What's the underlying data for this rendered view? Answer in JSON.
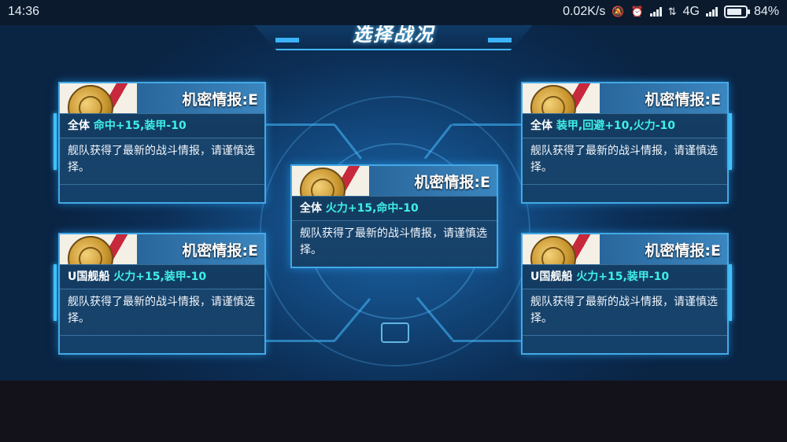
{
  "status_bar": {
    "time": "14:36",
    "net_speed": "0.02K/s",
    "network_type": "4G",
    "battery": "84%"
  },
  "screen": {
    "title": "选择战况"
  },
  "cards": [
    {
      "title": "机密情报:E",
      "target": "全体",
      "effect": "命中+15,装甲-10",
      "description": "舰队获得了最新的战斗情报，请谨慎选择。"
    },
    {
      "title": "机密情报:E",
      "target": "全体",
      "effect": "装甲,回避+10,火力-10",
      "description": "舰队获得了最新的战斗情报，请谨慎选择。"
    },
    {
      "title": "机密情报:E",
      "target": "全体",
      "effect": "火力+15,命中-10",
      "description": "舰队获得了最新的战斗情报，请谨慎选择。"
    },
    {
      "title": "机密情报:E",
      "target": "U国舰船",
      "effect": "火力+15,装甲-10",
      "description": "舰队获得了最新的战斗情报，请谨慎选择。"
    },
    {
      "title": "机密情报:E",
      "target": "U国舰船",
      "effect": "火力+15,装甲-10",
      "description": "舰队获得了最新的战斗情报，请谨慎选择。"
    }
  ],
  "colors": {
    "highlight": "#3ff0e8",
    "card_border": "#43a9e6",
    "accent_red": "#c8283b"
  }
}
